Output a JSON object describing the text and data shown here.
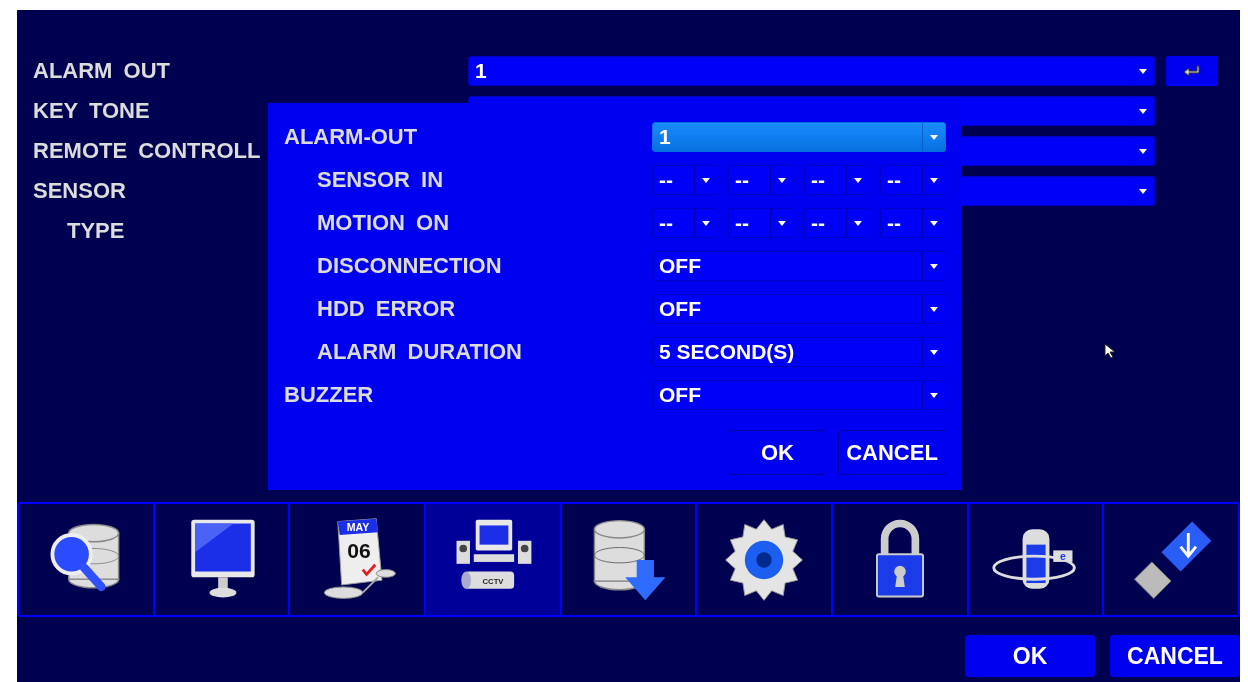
{
  "settings": [
    {
      "label": "ALARM OUT",
      "value": "1"
    },
    {
      "label": "KEY TONE"
    },
    {
      "label": "REMOTE CONTROLL"
    },
    {
      "label": "SENSOR",
      "children": [
        {
          "label": "TYPE"
        }
      ]
    }
  ],
  "dialog": {
    "rows": [
      {
        "label": "ALARM-OUT",
        "kind": "select",
        "value": "1",
        "selected": true,
        "children": [
          {
            "label": "SENSOR IN",
            "kind": "multi",
            "values": [
              "--",
              "--",
              "--",
              "--"
            ]
          },
          {
            "label": "MOTION ON",
            "kind": "multi",
            "values": [
              "--",
              "--",
              "--",
              "--"
            ]
          },
          {
            "label": "DISCONNECTION",
            "kind": "select",
            "value": "OFF",
            "selected": false
          },
          {
            "label": "HDD ERROR",
            "kind": "select",
            "value": "OFF",
            "selected": false
          },
          {
            "label": "ALARM DURATION",
            "kind": "select",
            "value": "5 SECOND(S)",
            "selected": false
          }
        ]
      },
      {
        "label": "BUZZER",
        "kind": "select",
        "value": "OFF",
        "selected": false
      }
    ],
    "buttons": [
      "OK",
      "CANCEL"
    ]
  },
  "menu_icons": [
    {
      "kind": "search",
      "selected": false
    },
    {
      "kind": "display",
      "selected": false
    },
    {
      "kind": "schedule",
      "selected": false,
      "month": "MAY",
      "day": "06"
    },
    {
      "kind": "devices",
      "selected": true,
      "label": "CCTV"
    },
    {
      "kind": "backup",
      "selected": false
    },
    {
      "kind": "setup",
      "selected": false
    },
    {
      "kind": "lock",
      "selected": false
    },
    {
      "kind": "network",
      "selected": false,
      "label": "e"
    },
    {
      "kind": "usb",
      "selected": false
    }
  ],
  "buttons": [
    "OK",
    "CANCEL"
  ]
}
